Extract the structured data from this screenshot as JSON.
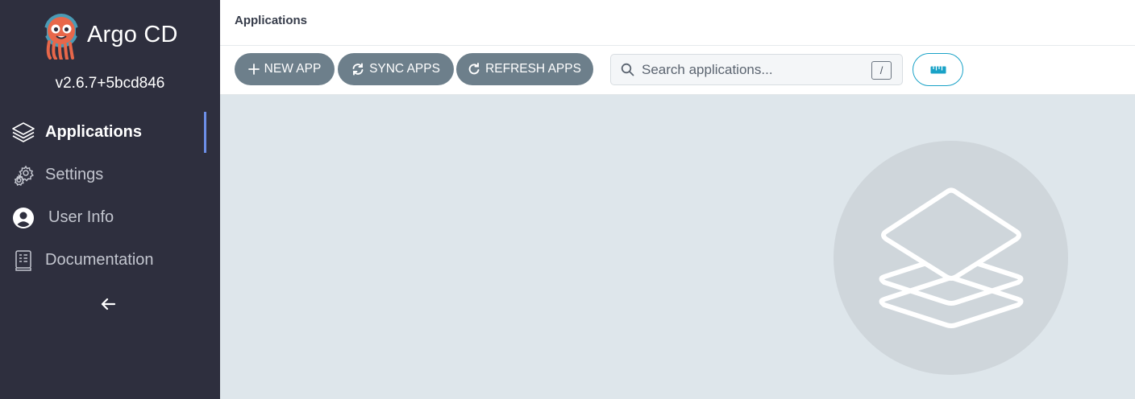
{
  "sidebar": {
    "brand": "Argo CD",
    "version": "v2.6.7+5bcd846",
    "items": [
      {
        "label": "Applications",
        "icon": "layers-icon",
        "active": true
      },
      {
        "label": "Settings",
        "icon": "gears-icon",
        "active": false
      },
      {
        "label": "User Info",
        "icon": "user-circle-icon",
        "active": false
      },
      {
        "label": "Documentation",
        "icon": "book-icon",
        "active": false
      }
    ],
    "collapse_icon": "arrow-left-icon"
  },
  "header": {
    "breadcrumb": "Applications"
  },
  "toolbar": {
    "new_app": "NEW APP",
    "sync_apps": "SYNC APPS",
    "refresh_apps": "REFRESH APPS",
    "search_placeholder": "Search applications...",
    "search_shortcut": "/",
    "view_toggle_icon": "ruler-icon"
  },
  "empty_state": {
    "icon": "layers-icon"
  },
  "colors": {
    "sidebar_bg": "#2e2f3e",
    "accent": "#6d8fe8",
    "button_bg": "#6d7f8b",
    "teal": "#19a2c7",
    "content_bg": "#dee6eb"
  }
}
